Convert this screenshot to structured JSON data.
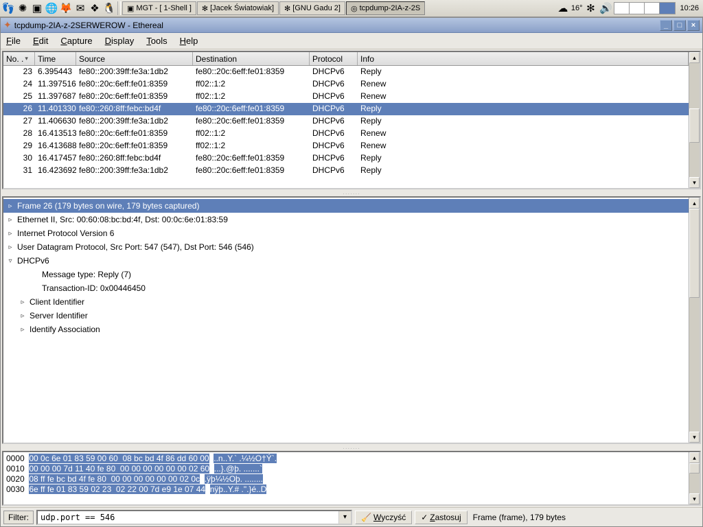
{
  "taskbar": {
    "temp": "16°",
    "clock": "10:26",
    "tasks": [
      {
        "label": "MGT - [ 1-Shell ]",
        "icon": "▣"
      },
      {
        "label": "[Jacek Światowiak]",
        "icon": "✻"
      },
      {
        "label": "[GNU Gadu 2]",
        "icon": "✻"
      },
      {
        "label": "tcpdump-2IA-z-2S",
        "icon": "◎",
        "active": true
      }
    ]
  },
  "window": {
    "title": "tcpdump-2IA-z-2SERWEROW - Ethereal"
  },
  "menu": {
    "items": [
      "File",
      "Edit",
      "Capture",
      "Display",
      "Tools",
      "Help"
    ]
  },
  "columns": {
    "no": "No. .",
    "time": "Time",
    "src": "Source",
    "dst": "Destination",
    "proto": "Protocol",
    "info": "Info"
  },
  "packets": [
    {
      "no": "23",
      "time": "6.395443",
      "src": "fe80::200:39ff:fe3a:1db2",
      "dst": "fe80::20c:6eff:fe01:8359",
      "proto": "DHCPv6",
      "info": "Reply"
    },
    {
      "no": "24",
      "time": "11.397516",
      "src": "fe80::20c:6eff:fe01:8359",
      "dst": "ff02::1:2",
      "proto": "DHCPv6",
      "info": "Renew"
    },
    {
      "no": "25",
      "time": "11.397687",
      "src": "fe80::20c:6eff:fe01:8359",
      "dst": "ff02::1:2",
      "proto": "DHCPv6",
      "info": "Renew"
    },
    {
      "no": "26",
      "time": "11.401330",
      "src": "fe80::260:8ff:febc:bd4f",
      "dst": "fe80::20c:6eff:fe01:8359",
      "proto": "DHCPv6",
      "info": "Reply",
      "selected": true
    },
    {
      "no": "27",
      "time": "11.406630",
      "src": "fe80::200:39ff:fe3a:1db2",
      "dst": "fe80::20c:6eff:fe01:8359",
      "proto": "DHCPv6",
      "info": "Reply"
    },
    {
      "no": "28",
      "time": "16.413513",
      "src": "fe80::20c:6eff:fe01:8359",
      "dst": "ff02::1:2",
      "proto": "DHCPv6",
      "info": "Renew"
    },
    {
      "no": "29",
      "time": "16.413688",
      "src": "fe80::20c:6eff:fe01:8359",
      "dst": "ff02::1:2",
      "proto": "DHCPv6",
      "info": "Renew"
    },
    {
      "no": "30",
      "time": "16.417457",
      "src": "fe80::260:8ff:febc:bd4f",
      "dst": "fe80::20c:6eff:fe01:8359",
      "proto": "DHCPv6",
      "info": "Reply"
    },
    {
      "no": "31",
      "time": "16.423692",
      "src": "fe80::200:39ff:fe3a:1db2",
      "dst": "fe80::20c:6eff:fe01:8359",
      "proto": "DHCPv6",
      "info": "Reply"
    }
  ],
  "tree": [
    {
      "label": "Frame 26 (179 bytes on wire, 179 bytes captured)",
      "icon": "▹",
      "selected": true
    },
    {
      "label": "Ethernet II, Src: 00:60:08:bc:bd:4f, Dst: 00:0c:6e:01:83:59",
      "icon": "▹"
    },
    {
      "label": "Internet Protocol Version 6",
      "icon": "▹"
    },
    {
      "label": "User Datagram Protocol, Src Port: 547 (547), Dst Port: 546 (546)",
      "icon": "▹"
    },
    {
      "label": "DHCPv6",
      "icon": "▿"
    },
    {
      "label": "Message type: Reply (7)",
      "indent": 2,
      "icon": ""
    },
    {
      "label": "Transaction-ID: 0x00446450",
      "indent": 2,
      "icon": ""
    },
    {
      "label": "Client Identifier",
      "indent": 1,
      "icon": "▹"
    },
    {
      "label": "Server Identifier",
      "indent": 1,
      "icon": "▹"
    },
    {
      "label": "Identify Association",
      "indent": 1,
      "icon": "▹"
    }
  ],
  "hex": [
    {
      "off": "0000",
      "bytes": "00 0c 6e 01 83 59 00 60  08 bc bd 4f 86 dd 60 00",
      "ascii": "..n..Y.` .¼½O†Ý`."
    },
    {
      "off": "0010",
      "bytes": "00 00 00 7d 11 40 fe 80  00 00 00 00 00 00 02 60",
      "ascii": "...}.@þ. .......`"
    },
    {
      "off": "0020",
      "bytes": "08 ff fe bc bd 4f fe 80  00 00 00 00 00 00 02 0c",
      "ascii": ".ÿþ¼½Oþ. ........"
    },
    {
      "off": "0030",
      "bytes": "6e ff fe 01 83 59 02 23  02 22 00 7d e9 1e 07 44",
      "ascii": "nÿþ..Y.# .\".}é..D"
    }
  ],
  "filter": {
    "label": "Filter:",
    "value": "udp.port == 546",
    "clear_label": "Wyczyść",
    "apply_label": "Zastosuj",
    "status": "Frame (frame), 179 bytes"
  }
}
